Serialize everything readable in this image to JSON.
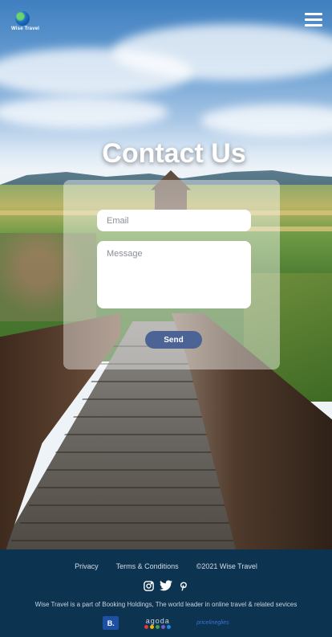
{
  "header": {
    "logo_text": "Wise Travel",
    "menu_icon": "hamburger-icon"
  },
  "contact": {
    "title": "Contact Us",
    "email_placeholder": "Email",
    "message_placeholder": "Message",
    "send_label": "Send"
  },
  "footer": {
    "links": [
      "Privacy",
      "Terms & Conditions",
      "©2021 Wise Travel"
    ],
    "social_icons": [
      "instagram-icon",
      "twitter-icon",
      "pinterest-icon"
    ],
    "tagline": "Wise Travel is a part of Booking Holdings, The world leader in online travel & related sevices",
    "brands": {
      "booking": "B.",
      "agoda": "agoda",
      "priceline": "pricelineglies"
    }
  },
  "colors": {
    "footer_bg": "#0c3350",
    "send_button": "#4b6495",
    "agoda_dots": [
      "#e53935",
      "#f4b400",
      "#43a047",
      "#7e57c2",
      "#1e88e5"
    ]
  }
}
